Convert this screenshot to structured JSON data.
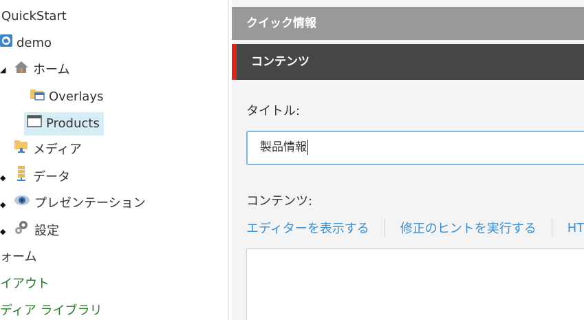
{
  "tree": {
    "items": [
      {
        "label": "QuickStart"
      },
      {
        "label": "demo"
      },
      {
        "label": "ホーム"
      },
      {
        "label": "Overlays"
      },
      {
        "label": "Products"
      },
      {
        "label": "メディア"
      },
      {
        "label": "データ"
      },
      {
        "label": "プレゼンテーション"
      },
      {
        "label": "設定"
      },
      {
        "label": "ォーム"
      },
      {
        "label": "イアウト"
      },
      {
        "label": "ディア ライブラリ"
      }
    ]
  },
  "main": {
    "quick_info": "クイック情報",
    "content_header": "コンテンツ",
    "title_label": "タイトル:",
    "title_value": "製品情報",
    "content_label": "コンテンツ:",
    "links": [
      "エディターを表示する",
      "修正のヒントを実行する",
      "HT"
    ]
  },
  "colors": {
    "accent": "#d8281e",
    "link": "#3b8fd0",
    "selected": "#d7edf6"
  }
}
